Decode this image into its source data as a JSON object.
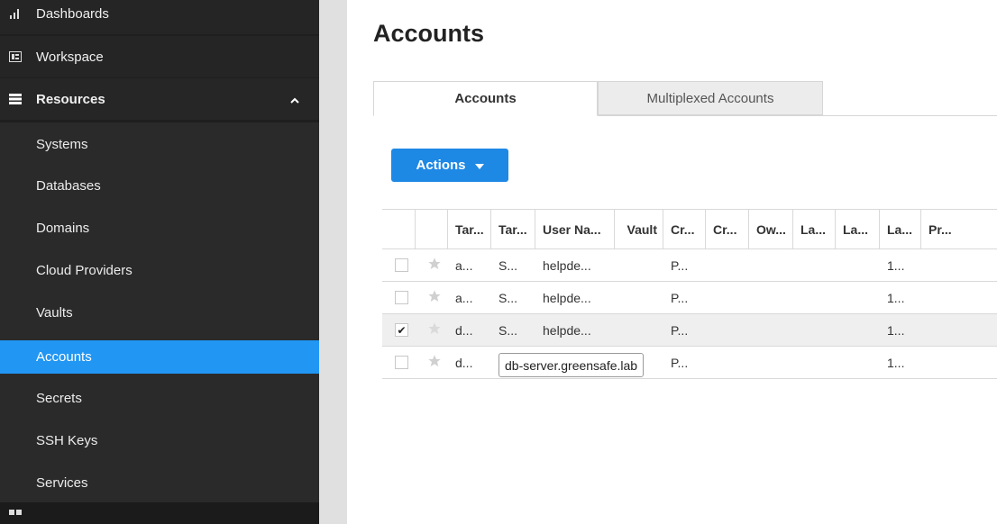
{
  "sidebar": {
    "top_items": [
      {
        "label": "Dashboards",
        "icon": "bar-chart-icon"
      },
      {
        "label": "Workspace",
        "icon": "workspace-icon"
      },
      {
        "label": "Resources",
        "icon": "list-icon",
        "expanded": true
      }
    ],
    "sub_items": [
      {
        "label": "Systems"
      },
      {
        "label": "Databases"
      },
      {
        "label": "Domains"
      },
      {
        "label": "Cloud Providers"
      },
      {
        "label": "Vaults"
      },
      {
        "label": "Accounts",
        "active": true
      },
      {
        "label": "Secrets"
      },
      {
        "label": "SSH Keys"
      },
      {
        "label": "Services"
      }
    ],
    "active_color": "#2196f3"
  },
  "main": {
    "title": "Accounts",
    "tabs": [
      {
        "label": "Accounts",
        "active": true
      },
      {
        "label": "Multiplexed Accounts",
        "active": false
      }
    ],
    "actions_label": "Actions",
    "accent_color": "#1e88e5"
  },
  "grid": {
    "columns": [
      "Tar...",
      "Tar...",
      "User Na...",
      "Vault",
      "Cr...",
      "Cr...",
      "Ow...",
      "La...",
      "La...",
      "La...",
      "Pr..."
    ],
    "rows": [
      {
        "checked": false,
        "cells": [
          "a...",
          "S...",
          "helpde...",
          "",
          "P...",
          "",
          "",
          "",
          "",
          "1...",
          ""
        ]
      },
      {
        "checked": false,
        "cells": [
          "a...",
          "S...",
          "helpde...",
          "",
          "P...",
          "",
          "",
          "",
          "",
          "1...",
          ""
        ]
      },
      {
        "checked": true,
        "cells": [
          "d...",
          "S...",
          "helpde...",
          "",
          "P...",
          "",
          "",
          "",
          "",
          "1...",
          ""
        ]
      },
      {
        "checked": false,
        "cells": [
          "d...",
          "",
          "",
          "",
          "P...",
          "",
          "",
          "",
          "",
          "1...",
          ""
        ]
      }
    ],
    "check_mark": "✔"
  },
  "tooltip": {
    "text": "db-server.greensafe.lab"
  }
}
